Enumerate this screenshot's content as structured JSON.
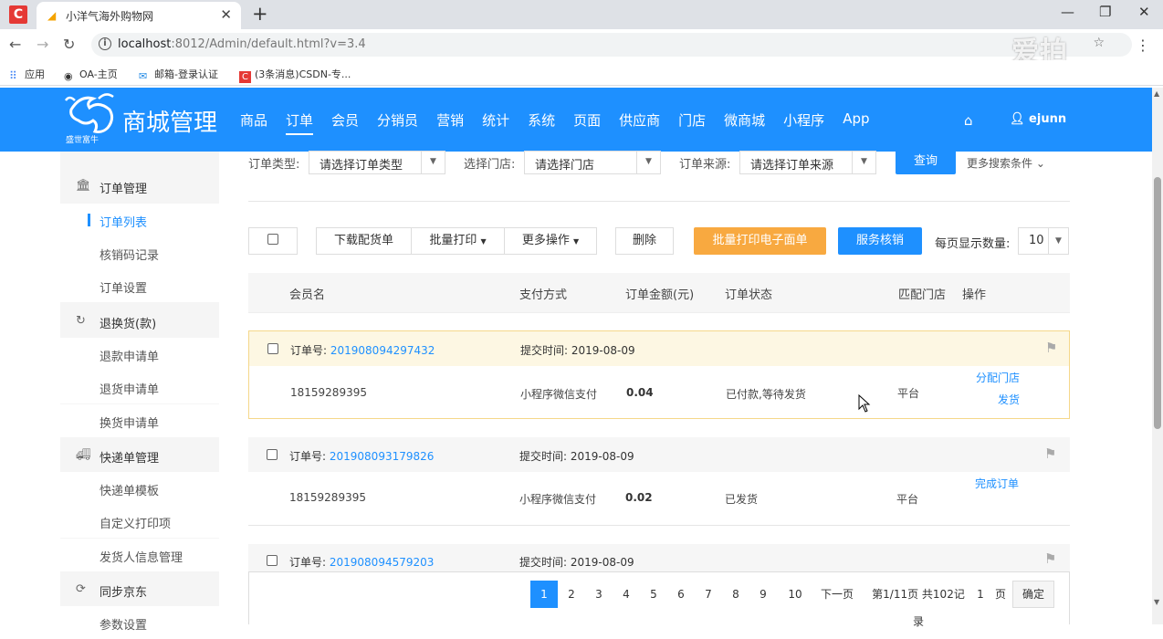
{
  "browser": {
    "tab_title": "小洋气海外购物网",
    "url_host": "localhost",
    "url_rest": ":8012/Admin/default.html?v=3.4",
    "watermark": "爱拍",
    "bookmarks": [
      "应用",
      "OA-主页",
      "邮箱-登录认证",
      "(3条消息)CSDN-专..."
    ]
  },
  "header": {
    "brand_title": "商城管理",
    "brand_sub": "盛世富牛",
    "nav": [
      "商品",
      "订单",
      "会员",
      "分销员",
      "营销",
      "统计",
      "系统",
      "页面",
      "供应商",
      "门店",
      "微商城",
      "小程序",
      "App"
    ],
    "active_nav": "订单",
    "user": "ejunn"
  },
  "sidebar": {
    "groups": [
      {
        "label": "订单管理",
        "icon": "bank-icon",
        "items": [
          "订单列表",
          "核销码记录",
          "订单设置"
        ]
      },
      {
        "label": "退换货(款)",
        "icon": "refresh-icon",
        "items": [
          "退款申请单",
          "退货申请单",
          "换货申请单"
        ]
      },
      {
        "label": "快递单管理",
        "icon": "truck-icon",
        "items": [
          "快递单模板",
          "自定义打印项",
          "发货人信息管理"
        ]
      },
      {
        "label": "同步京东",
        "icon": "sync-icon",
        "items": [
          "参数设置"
        ]
      }
    ],
    "active_item": "订单列表"
  },
  "filters": {
    "type_label": "订单类型:",
    "type_value": "请选择订单类型",
    "store_label": "选择门店:",
    "store_value": "请选择门店",
    "source_label": "订单来源:",
    "source_value": "请选择订单来源",
    "query_button": "查询",
    "more_search": "更多搜索条件"
  },
  "actions": {
    "download": "下载配货单",
    "batch_print": "批量打印",
    "more_ops": "更多操作",
    "delete": "删除",
    "batch_print_e": "批量打印电子面单",
    "service_verify": "服务核销",
    "per_page_label": "每页显示数量:",
    "per_page_value": "10"
  },
  "table_headers": [
    "会员名",
    "支付方式",
    "订单金额(元)",
    "订单状态",
    "匹配门店",
    "操作"
  ],
  "orders": [
    {
      "no_label": "订单号:",
      "no": "201908094297432",
      "time_label": "提交时间:",
      "time": "2019-08-09",
      "member": "18159289395",
      "payment": "小程序微信支付",
      "amount": "0.04",
      "status": "已付款,等待发货",
      "store": "平台",
      "ops": [
        "分配门店",
        "发货"
      ]
    },
    {
      "no_label": "订单号:",
      "no": "201908093179826",
      "time_label": "提交时间:",
      "time": "2019-08-09",
      "member": "18159289395",
      "payment": "小程序微信支付",
      "amount": "0.02",
      "status": "已发货",
      "store": "平台",
      "ops": [
        "完成订单"
      ]
    },
    {
      "no_label": "订单号:",
      "no": "201908094579203",
      "time_label": "提交时间:",
      "time": "2019-08-09"
    }
  ],
  "pager": {
    "pages": [
      "1",
      "2",
      "3",
      "4",
      "5",
      "6",
      "7",
      "8",
      "9",
      "10"
    ],
    "current": "1",
    "next": "下一页",
    "summary": "第1/11页 共102记录",
    "goto_value": "1",
    "page_unit": "页",
    "confirm": "确定"
  },
  "colors": {
    "primary": "#1e90ff",
    "orange": "#f8a940",
    "highlight_bg": "#fdf7e3"
  }
}
